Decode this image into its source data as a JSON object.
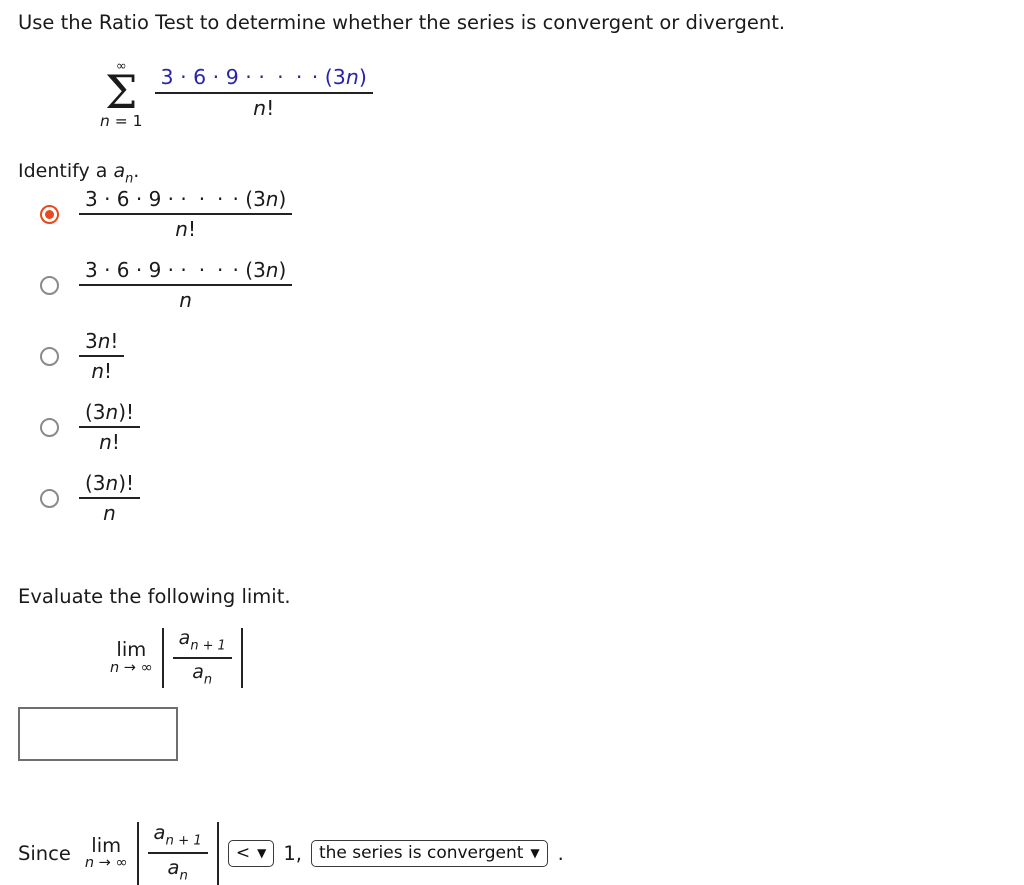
{
  "prompts": {
    "main": "Use the Ratio Test to determine whether the series is convergent or divergent.",
    "identify": "Identify a",
    "identify_sub": "n",
    "identify_period": ".",
    "limit": "Evaluate the following limit."
  },
  "series": {
    "sigma_top": "∞",
    "sigma_glyph": "Σ",
    "sigma_bottom_var": "n",
    "sigma_bottom_rest": " = 1",
    "numerator": "3 · 6 · 9 · · · · · (3n)",
    "numerator_parts": {
      "lead": "3 · 6 · 9 · ",
      "dots": "· · ·",
      "tail_sep": " · (3",
      "tail_var": "n",
      "tail_close": ")"
    },
    "denominator_var": "n",
    "denominator_bang": "!",
    "numerator_color": "#2a24a8"
  },
  "options": [
    {
      "id": "option-1",
      "selected": true,
      "numerator_lead": "3 · 6 · 9 · ",
      "numerator_dots": "· · ·",
      "numerator_sep": " · (3",
      "numerator_var": "n",
      "numerator_close": ")",
      "denominator_var": "n",
      "denominator_suffix": "!",
      "label": "3 · 6 · 9 · · · · · (3n) / n!"
    },
    {
      "id": "option-2",
      "selected": false,
      "numerator_lead": "3 · 6 · 9 · ",
      "numerator_dots": "· · ·",
      "numerator_sep": " · (3",
      "numerator_var": "n",
      "numerator_close": ")",
      "denominator_var": "n",
      "denominator_suffix": "",
      "label": "3 · 6 · 9 · · · · · (3n) / n"
    },
    {
      "id": "option-3",
      "selected": false,
      "numerator_plain": "3",
      "numerator_var": "n",
      "numerator_close": "!",
      "denominator_var": "n",
      "denominator_suffix": "!",
      "label": "3n! / n!"
    },
    {
      "id": "option-4",
      "selected": false,
      "numerator_plain": "(3",
      "numerator_var": "n",
      "numerator_close": ")!",
      "denominator_var": "n",
      "denominator_suffix": "!",
      "label": "(3n)! / n!"
    },
    {
      "id": "option-5",
      "selected": false,
      "numerator_plain": "(3",
      "numerator_var": "n",
      "numerator_close": ")!",
      "denominator_var": "n",
      "denominator_suffix": "",
      "label": "(3n)! / n"
    }
  ],
  "limit_expression": {
    "lim_word": "lim",
    "lim_under_var": "n",
    "lim_under_rest": " → ∞",
    "numerator_var": "a",
    "numerator_sub": "n + 1",
    "denominator_var": "a",
    "denominator_sub": "n"
  },
  "answer_input": {
    "value": "",
    "placeholder": ""
  },
  "conclusion": {
    "lead": "Since",
    "lim_word": "lim",
    "lim_under_var": "n",
    "lim_under_rest": " → ∞",
    "numerator_var": "a",
    "numerator_sub": "n + 1",
    "denominator_var": "a",
    "denominator_sub": "n",
    "comparison_value": "<",
    "comparison_caret": "⌄",
    "threshold": "1,",
    "verdict_value": "the series is convergent",
    "verdict_caret": "⌄",
    "period": "."
  }
}
